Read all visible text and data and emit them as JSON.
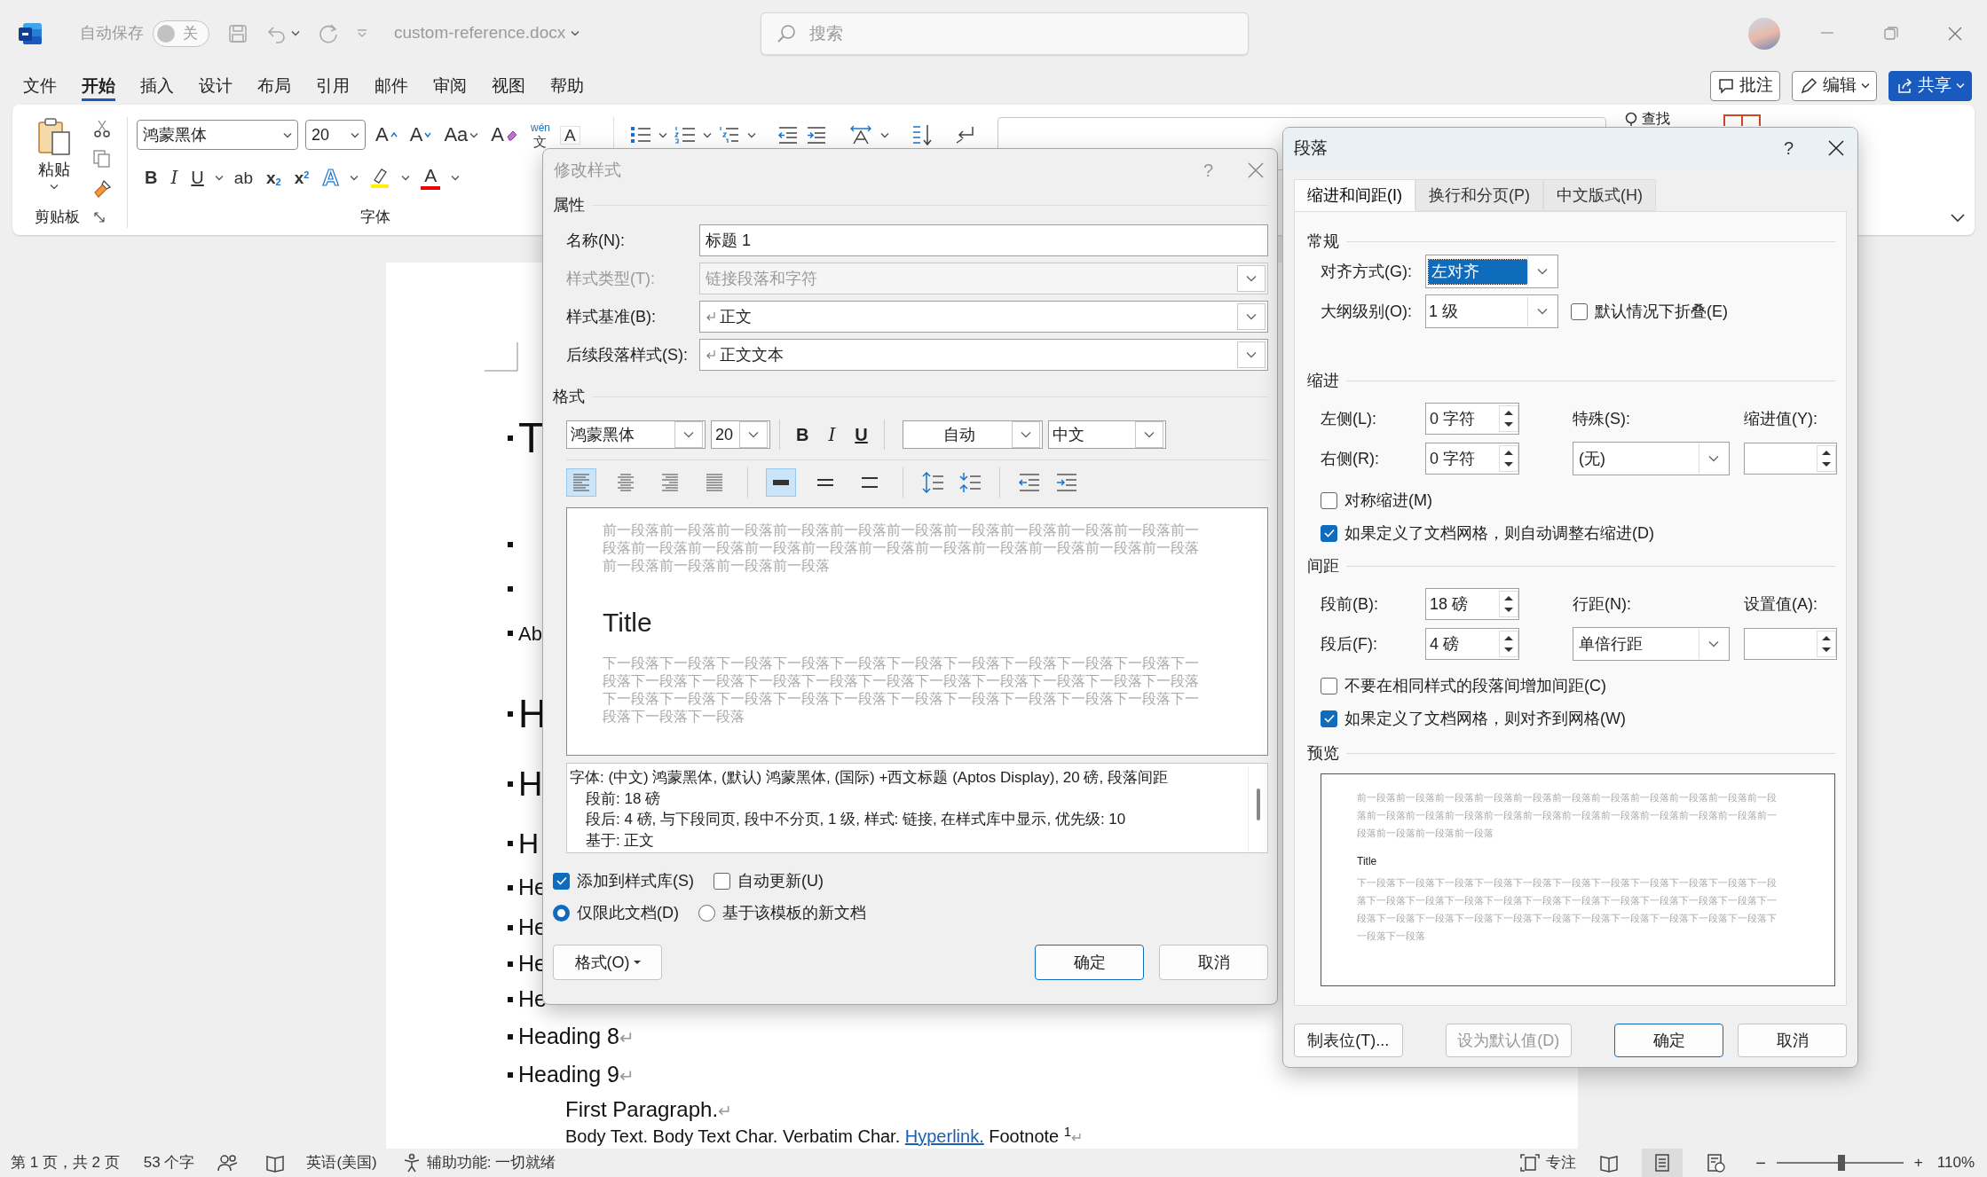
{
  "title_bar": {
    "autosave_label": "自动保存",
    "autosave_toggle": {
      "label": "关",
      "on": false
    },
    "filename": "custom-reference.docx",
    "search": {
      "placeholder": "搜索"
    }
  },
  "menu_tabs": [
    {
      "label": "文件",
      "selected": false
    },
    {
      "label": "开始",
      "selected": true
    },
    {
      "label": "插入",
      "selected": false
    },
    {
      "label": "设计",
      "selected": false
    },
    {
      "label": "布局",
      "selected": false
    },
    {
      "label": "引用",
      "selected": false
    },
    {
      "label": "邮件",
      "selected": false
    },
    {
      "label": "审阅",
      "selected": false
    },
    {
      "label": "视图",
      "selected": false
    },
    {
      "label": "帮助",
      "selected": false
    }
  ],
  "header_buttons": [
    {
      "label": "批注",
      "kind": "comment"
    },
    {
      "label": "编辑",
      "kind": "edit"
    },
    {
      "label": "共享",
      "kind": "share"
    }
  ],
  "ribbon": {
    "paste_label": "粘贴",
    "clipboard_label": "剪贴板",
    "font_name": "鸿蒙黑体",
    "font_size": "20",
    "font_tools": [
      {
        "kind": "grow",
        "glyph": "A"
      },
      {
        "kind": "shrink",
        "glyph": "A"
      },
      {
        "kind": "case",
        "glyph": "Aa"
      },
      {
        "kind": "clear",
        "glyph": "A"
      },
      {
        "kind": "phonetic",
        "glyph": "wén",
        "glyph2": "文"
      },
      {
        "kind": "border",
        "glyph": "A"
      }
    ],
    "format_tools": [
      {
        "kind": "bold",
        "glyph": "B"
      },
      {
        "kind": "italic",
        "glyph": "I"
      },
      {
        "kind": "underline",
        "glyph": "U"
      },
      {
        "kind": "strike",
        "glyph": "ab"
      },
      {
        "kind": "sub",
        "glyph": "x$_{2}$"
      },
      {
        "kind": "sup",
        "glyph": "x$^{2}$"
      },
      {
        "kind": "effects",
        "glyph": "A"
      },
      {
        "kind": "highlight"
      },
      {
        "kind": "color",
        "glyph": "A"
      }
    ],
    "font_label": "字体",
    "find_label": "查找"
  },
  "document": {
    "lines": [
      {
        "kind": "title",
        "bullet": true,
        "text": "T"
      },
      {
        "kind": "empty",
        "bullet": true
      },
      {
        "kind": "empty",
        "bullet": true
      },
      {
        "kind": "subtitle",
        "bullet": true,
        "text": "Ab"
      },
      {
        "kind": "h1",
        "bullet": true,
        "text": "H"
      },
      {
        "kind": "h2",
        "bullet": true,
        "text": "H"
      },
      {
        "kind": "h3",
        "bullet": true,
        "text": "H"
      },
      {
        "kind": "h4",
        "bullet": true,
        "text": "He"
      },
      {
        "kind": "h5",
        "bullet": true,
        "text": "He"
      },
      {
        "kind": "h6",
        "bullet": true,
        "text": "He"
      },
      {
        "kind": "h7",
        "bullet": true,
        "text": "He"
      },
      {
        "kind": "h8",
        "bullet": true,
        "text": "Heading 8",
        "mark": "↵"
      },
      {
        "kind": "h9",
        "bullet": true,
        "text": "Heading 9",
        "mark": "↵"
      },
      {
        "kind": "first",
        "bullet": false,
        "text": "First Paragraph.",
        "mark": "↵"
      },
      {
        "kind": "body",
        "bullet": false,
        "segments": [
          {
            "kind": "plain",
            "text": "Body Text. Body Text Char. Verbatim Char. "
          },
          {
            "kind": "link",
            "text": "Hyperlink."
          },
          {
            "kind": "plain",
            "text": " Footnote $^{1}$"
          }
        ],
        "mark": "↵"
      }
    ]
  },
  "modify_style_dialog": {
    "title": "修改样式",
    "help": "?",
    "properties_heading": "属性",
    "properties": [
      {
        "label": "名称(N):",
        "value": "标题 1",
        "kind": "text",
        "disabled": false
      },
      {
        "label": "样式类型(T):",
        "value": "链接段落和字符",
        "kind": "select",
        "disabled": true
      },
      {
        "label": "样式基准(B):",
        "value": "正文",
        "kind": "style-select",
        "disabled": false
      },
      {
        "label": "后续段落样式(S):",
        "value": "正文文本",
        "kind": "style-select",
        "disabled": false
      }
    ],
    "format_heading": "格式",
    "font_name": "鸿蒙黑体",
    "font_size": "20",
    "style_buttons": [
      {
        "kind": "bold",
        "glyph": "B"
      },
      {
        "kind": "italic",
        "glyph": "I"
      },
      {
        "kind": "underline",
        "glyph": "U"
      }
    ],
    "font_color": "自动",
    "script": "中文",
    "align_buttons": [
      {
        "kind": "left",
        "selected": true
      },
      {
        "kind": "center",
        "selected": false
      },
      {
        "kind": "right",
        "selected": false
      },
      {
        "kind": "justify",
        "selected": false
      }
    ],
    "spacing_buttons": [
      {
        "kind": "single",
        "selected": true
      },
      {
        "kind": "onehalf",
        "selected": false
      },
      {
        "kind": "double",
        "selected": false
      }
    ],
    "preview": {
      "before": "前一段落前一段落前一段落前一段落前一段落前一段落前一段落前一段落前一段落前一段落前一段落前一段落前一段落前一段落前一段落前一段落前一段落前一段落前一段落前一段落前一段落前一段落前一段落前一段落前一段落",
      "sample": "Title",
      "after": "下一段落下一段落下一段落下一段落下一段落下一段落下一段落下一段落下一段落下一段落下一段落下一段落下一段落下一段落下一段落下一段落下一段落下一段落下一段落下一段落下一段落下一段落下一段落下一段落下一段落下一段落下一段落下一段落下一段落下一段落下一段落下一段落下一段落下一段落"
    },
    "description": {
      "summary": "字体: (中文) 鸿蒙黑体, (默认) 鸿蒙黑体, (国际) +西文标题 (Aptos Display), 20 磅, 段落间距",
      "details": [
        "段前: 18 磅",
        "段后: 4 磅, 与下段同页, 段中不分页, 1 级, 样式: 链接, 在样式库中显示, 优先级: 10",
        "基于: 正文"
      ]
    },
    "options": [
      {
        "label": "添加到样式库(S)",
        "checked": true
      },
      {
        "label": "自动更新(U)",
        "checked": false
      }
    ],
    "scope": [
      {
        "label": "仅限此文档(D)",
        "selected": true
      },
      {
        "label": "基于该模板的新文档",
        "selected": false
      }
    ],
    "buttons": [
      {
        "label": "格式(O)",
        "kind": "menu"
      },
      {
        "label": "确定",
        "kind": "default"
      },
      {
        "label": "取消",
        "kind": "normal"
      }
    ]
  },
  "paragraph_dialog": {
    "title": "段落",
    "help": "?",
    "tabs": [
      {
        "label": "缩进和间距(I)",
        "selected": true
      },
      {
        "label": "换行和分页(P)",
        "selected": false
      },
      {
        "label": "中文版式(H)",
        "selected": false
      }
    ],
    "general": {
      "heading": "常规",
      "alignment": {
        "label": "对齐方式(G):",
        "value": "左对齐",
        "focused": true
      },
      "outline": {
        "label": "大纲级别(O):",
        "value": "1 级",
        "focused": false
      },
      "collapse": {
        "label": "默认情况下折叠(E)",
        "checked": false
      }
    },
    "indent": {
      "heading": "缩进",
      "left": {
        "label": "左侧(L):",
        "value": "0 字符"
      },
      "right": {
        "label": "右侧(R):",
        "value": "0 字符"
      },
      "special": {
        "label": "特殊(S):",
        "value": "(无)"
      },
      "by": {
        "label": "缩进值(Y):"
      },
      "options": [
        {
          "label": "对称缩进(M)",
          "checked": false
        },
        {
          "label": "如果定义了文档网格，则自动调整右缩进(D)",
          "checked": true
        }
      ]
    },
    "spacing": {
      "heading": "间距",
      "before": {
        "label": "段前(B):",
        "value": "18 磅"
      },
      "after": {
        "label": "段后(F):",
        "value": "4 磅"
      },
      "line": {
        "label": "行距(N):",
        "value": "单倍行距"
      },
      "at": {
        "label": "设置值(A):"
      },
      "options": [
        {
          "label": "不要在相同样式的段落间增加间距(C)",
          "checked": false
        },
        {
          "label": "如果定义了文档网格，则对齐到网格(W)",
          "checked": true
        }
      ]
    },
    "preview": {
      "heading": "预览",
      "before": "前一段落前一段落前一段落前一段落前一段落前一段落前一段落前一段落前一段落前一段落前一段落前一段落前一段落前一段落前一段落前一段落前一段落前一段落前一段落前一段落前一段落前一段落前一段落前一段落前一段落",
      "sample": "Title",
      "after": "下一段落下一段落下一段落下一段落下一段落下一段落下一段落下一段落下一段落下一段落下一段落下一段落下一段落下一段落下一段落下一段落下一段落下一段落下一段落下一段落下一段落下一段落下一段落下一段落下一段落下一段落下一段落下一段落下一段落下一段落下一段落下一段落下一段落下一段落"
    },
    "buttons": [
      {
        "label": "制表位(T)...",
        "kind": "normal",
        "disabled": false
      },
      {
        "label": "设为默认值(D)",
        "kind": "normal",
        "disabled": true
      },
      {
        "label": "确定",
        "kind": "default",
        "disabled": false
      },
      {
        "label": "取消",
        "kind": "normal",
        "disabled": false
      }
    ]
  },
  "status_bar": {
    "page": "第 1 页，共 2 页",
    "words": "53 个字",
    "language": "英语(美国)",
    "accessibility": "辅助功能: 一切就绪",
    "focus": "专注",
    "views": [
      {
        "kind": "read",
        "selected": false
      },
      {
        "kind": "print",
        "selected": true
      },
      {
        "kind": "web",
        "selected": false
      }
    ],
    "zoom": {
      "out": "−",
      "in": "+",
      "level": 0.51,
      "reading": "110%"
    }
  }
}
